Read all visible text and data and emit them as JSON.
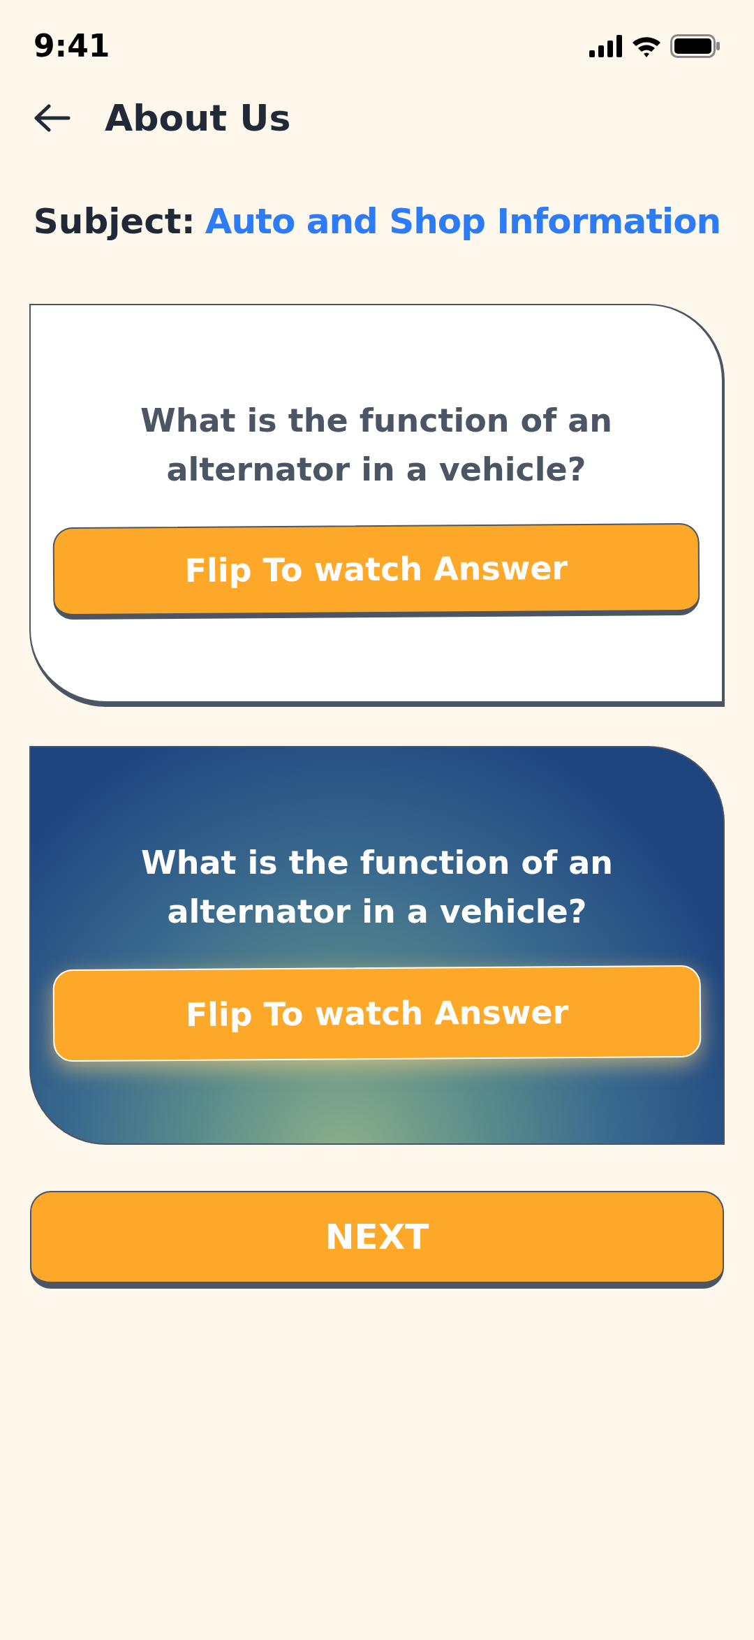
{
  "status_bar": {
    "time": "9:41"
  },
  "header": {
    "title": "About Us"
  },
  "subject": {
    "label": "Subject:",
    "value": "Auto and Shop Information"
  },
  "cards": [
    {
      "kind": "light",
      "question": "What is the function of an alternator in a vehicle?",
      "button": "Flip To watch Answer"
    },
    {
      "kind": "dark",
      "question": "What is the function of an alternator in a vehicle?",
      "button": "Flip To watch Answer"
    }
  ],
  "next_button": "NEXT"
}
